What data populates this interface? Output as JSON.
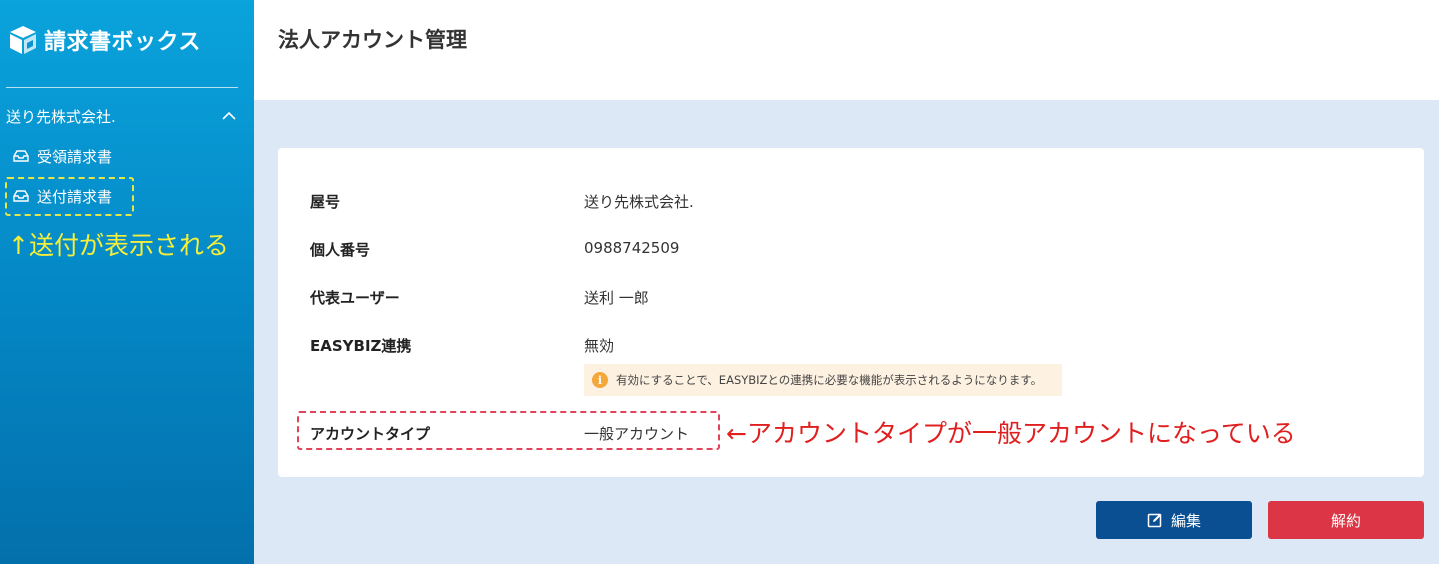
{
  "sidebar": {
    "logo_text": "請求書ボックス",
    "org_name": "送り先株式会社.",
    "nav": [
      {
        "label": "受領請求書",
        "icon": "inbox-icon"
      },
      {
        "label": "送付請求書",
        "icon": "inbox-icon"
      }
    ],
    "annotation": "↑送付が表示される"
  },
  "header": {
    "title": "法人アカウント管理"
  },
  "details": {
    "trade_name_label": "屋号",
    "trade_name_value": "送り先株式会社.",
    "personal_number_label": "個人番号",
    "personal_number_value": "0988742509",
    "representative_label": "代表ユーザー",
    "representative_value": "送利 一郎",
    "easybiz_label": "EASYBIZ連携",
    "easybiz_value": "無効",
    "easybiz_notice": "有効にすることで、EASYBIZとの連携に必要な機能が表示されるようになります。",
    "account_type_label": "アカウントタイプ",
    "account_type_value": "一般アカウント",
    "annotation": "←アカウントタイプが一般アカウントになっている"
  },
  "buttons": {
    "edit_label": "編集",
    "cancel_label": "解約"
  },
  "colors": {
    "sidebar_top": "#0aa3dc",
    "sidebar_bottom": "#0370ab",
    "edit_button": "#0b4f93",
    "cancel_button": "#dc3545",
    "notice_bg": "#fdf1e2",
    "info_icon": "#f4a73a",
    "annotation_yellow": "#f5ee3a",
    "annotation_red": "#e02020"
  }
}
